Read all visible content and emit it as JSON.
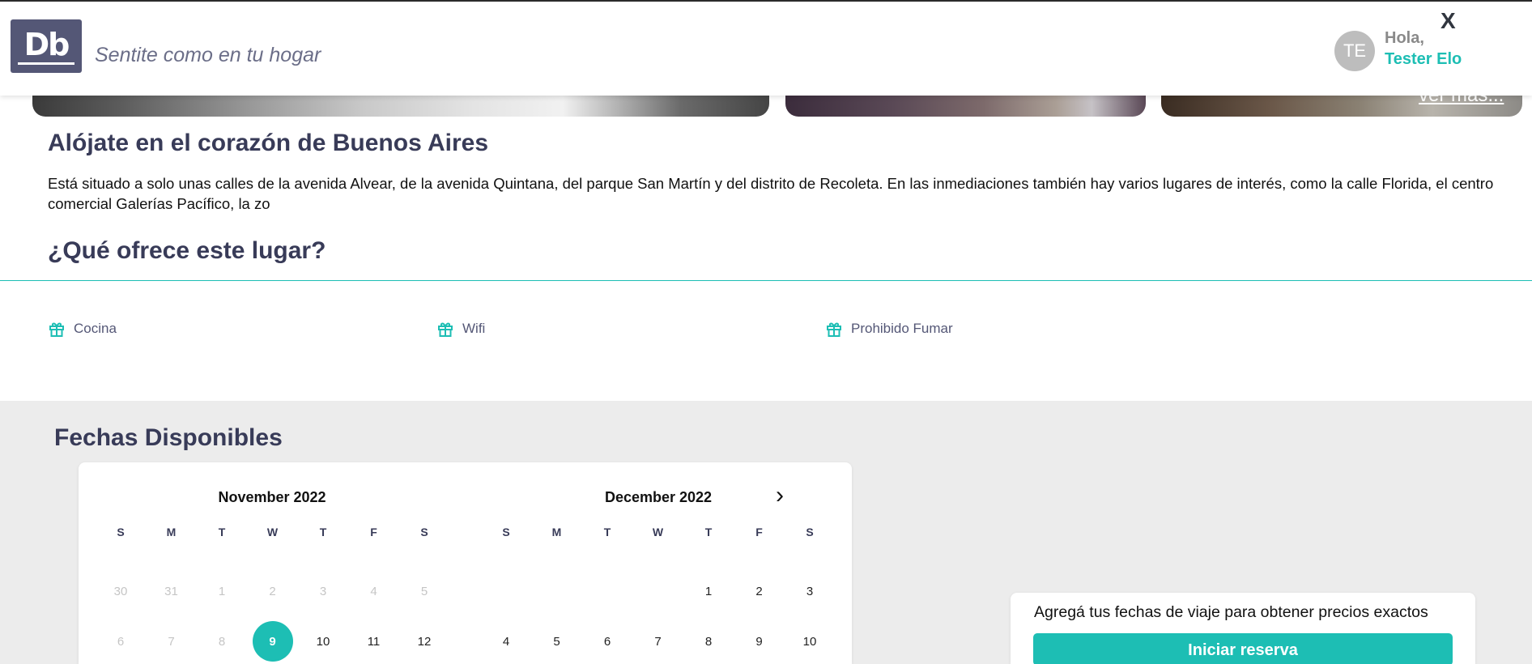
{
  "header": {
    "logo_text": "Db",
    "tagline": "Sentite como en tu hogar",
    "avatar_initials": "TE",
    "greeting": "Hola,",
    "user_name": "Tester Elo",
    "close_label": "X"
  },
  "gallery": {
    "more_link": "ver más..."
  },
  "description": {
    "title": "Alójate en el corazón de Buenos Aires",
    "text": "Está situado a solo unas calles de la avenida Alvear, de la avenida Quintana, del parque San Martín y del distrito de Recoleta. En las inmediaciones también hay varios lugares de interés, como la calle Florida, el centro comercial Galerías Pacífico, la zo"
  },
  "features": {
    "title": "¿Qué ofrece este lugar?",
    "icon": "gift-icon",
    "items": [
      "Cocina",
      "Wifi",
      "Prohibido Fumar"
    ]
  },
  "availability": {
    "title": "Fechas Disponibles",
    "weekdays": [
      "S",
      "M",
      "T",
      "W",
      "T",
      "F",
      "S"
    ],
    "months": [
      {
        "name": "November 2022",
        "rows": [
          [
            "30",
            "31",
            "1",
            "2",
            "3",
            "4",
            "5"
          ],
          [
            "6",
            "7",
            "8",
            "9",
            "10",
            "11",
            "12"
          ]
        ]
      },
      {
        "name": "December 2022",
        "rows": [
          [
            "",
            "",
            "",
            "",
            "1",
            "2",
            "3"
          ],
          [
            "4",
            "5",
            "6",
            "7",
            "8",
            "9",
            "10"
          ]
        ]
      }
    ],
    "selected_date": "9",
    "next_icon": "chevron-right-icon"
  },
  "booking": {
    "prompt": "Agregá tus fechas de viaje para obtener precios exactos",
    "button_label": "Iniciar reserva"
  },
  "colors": {
    "primary": "#1dbeb4",
    "dark": "#383b58",
    "logo_bg": "#545776"
  }
}
